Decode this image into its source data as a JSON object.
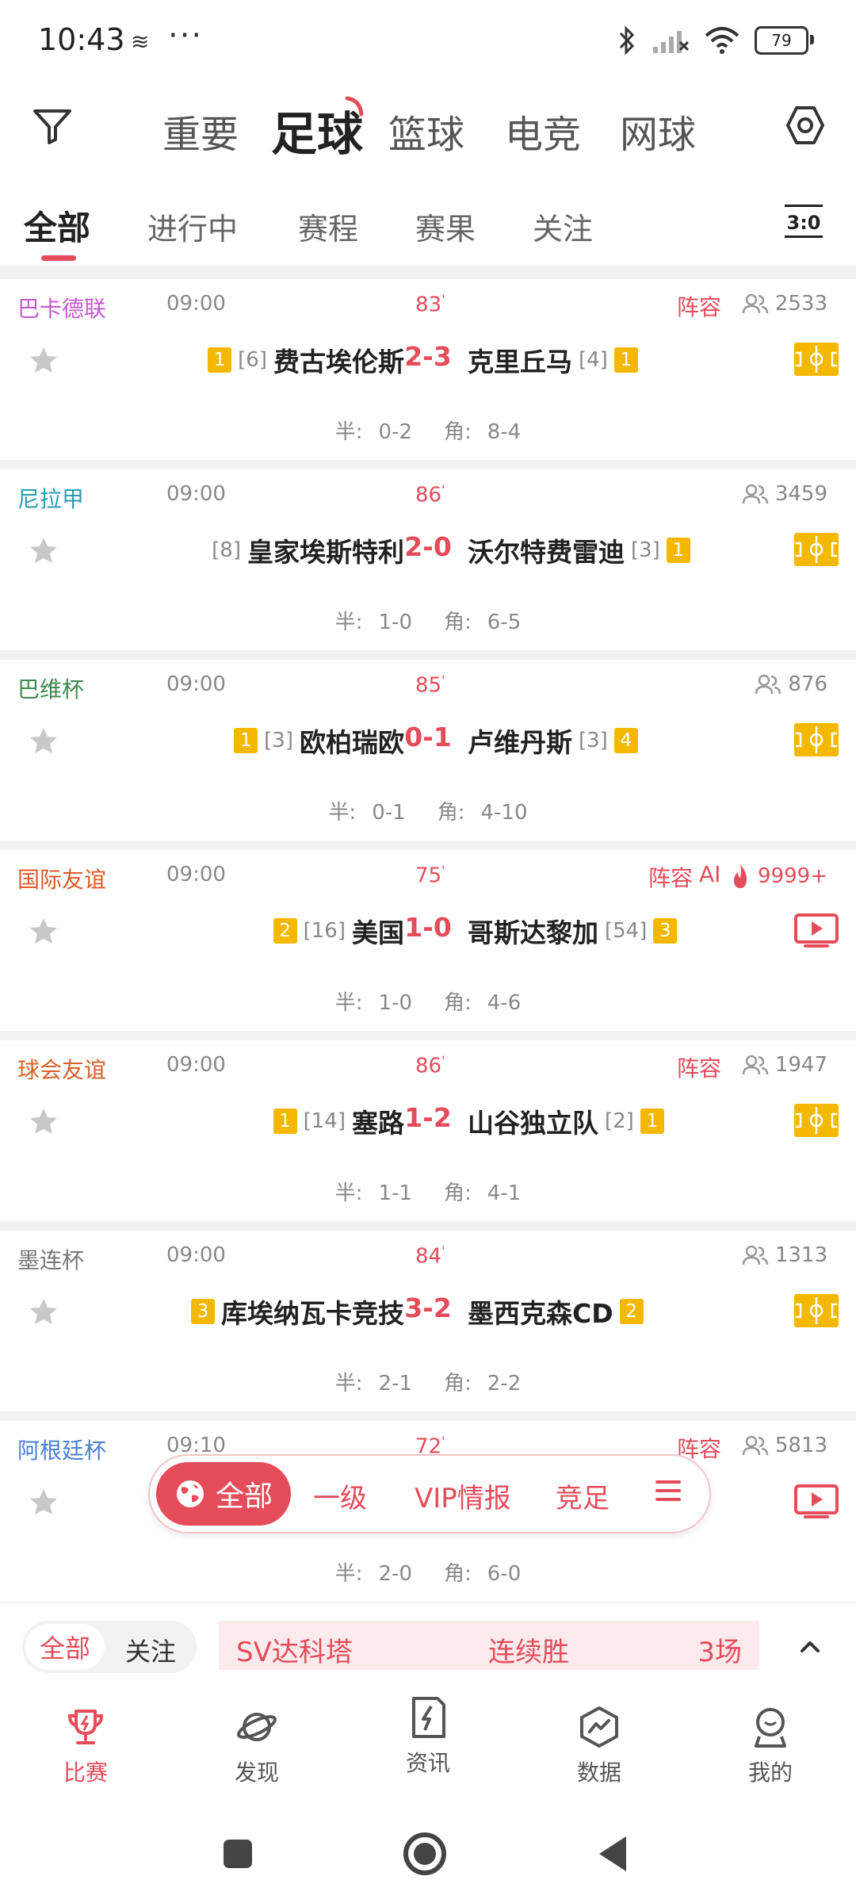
{
  "status": {
    "time": "10:43",
    "battery": "79"
  },
  "sports_tabs": [
    "重要",
    "足球",
    "篮球",
    "电竞",
    "网球"
  ],
  "sub_tabs": [
    "全部",
    "进行中",
    "赛程",
    "赛果",
    "关注"
  ],
  "colors": {
    "accent": "#e44c5a",
    "card_yellow": "#f5b800"
  },
  "matches": [
    {
      "league": "巴卡德联",
      "league_color": "#c45ad0",
      "time": "09:00",
      "minute": "83",
      "lineup": "阵容",
      "viewers": "2533",
      "home_card": "1",
      "home_rank": "[6]",
      "home": "费古埃伦斯",
      "score": "2-3",
      "away": "克里丘马",
      "away_rank": "[4]",
      "away_card": "1",
      "half_label": "半:",
      "half": "0-2",
      "corner_label": "角:",
      "corner": "8-4",
      "media": "pitch"
    },
    {
      "league": "尼拉甲",
      "league_color": "#2a9db4",
      "time": "09:00",
      "minute": "86",
      "lineup": "",
      "viewers": "3459",
      "home_card": "",
      "home_rank": "[8]",
      "home": "皇家埃斯特利",
      "score": "2-0",
      "away": "沃尔特费雷迪",
      "away_rank": "[3]",
      "away_card": "1",
      "half_label": "半:",
      "half": "1-0",
      "corner_label": "角:",
      "corner": "6-5",
      "media": "pitch"
    },
    {
      "league": "巴维杯",
      "league_color": "#3c8a4e",
      "time": "09:00",
      "minute": "85",
      "lineup": "",
      "viewers": "876",
      "home_card": "1",
      "home_rank": "[3]",
      "home": "欧柏瑞欧",
      "score": "0-1",
      "away": "卢维丹斯",
      "away_rank": "[3]",
      "away_card": "4",
      "half_label": "半:",
      "half": "0-1",
      "corner_label": "角:",
      "corner": "4-10",
      "media": "pitch"
    },
    {
      "league": "国际友谊",
      "league_color": "#e05a2a",
      "time": "09:00",
      "minute": "75",
      "lineup": "阵容",
      "ai": "AI",
      "viewers": "9999+",
      "hot": true,
      "home_card": "2",
      "home_rank": "[16]",
      "home": "美国",
      "score": "1-0",
      "away": "哥斯达黎加",
      "away_rank": "[54]",
      "away_card": "3",
      "half_label": "半:",
      "half": "1-0",
      "corner_label": "角:",
      "corner": "4-6",
      "media": "tv"
    },
    {
      "league": "球会友谊",
      "league_color": "#d4622a",
      "time": "09:00",
      "minute": "86",
      "lineup": "阵容",
      "viewers": "1947",
      "home_card": "1",
      "home_rank": "[14]",
      "home": "塞路",
      "score": "1-2",
      "away": "山谷独立队",
      "away_rank": "[2]",
      "away_card": "1",
      "half_label": "半:",
      "half": "1-1",
      "corner_label": "角:",
      "corner": "4-1",
      "media": "pitch"
    },
    {
      "league": "墨连杯",
      "league_color": "#777777",
      "time": "09:00",
      "minute": "84",
      "lineup": "",
      "viewers": "1313",
      "home_card": "3",
      "home_rank": "",
      "home": "库埃纳瓦卡竞技",
      "score": "3-2",
      "away": "墨西克森CD",
      "away_rank": "",
      "away_card": "2",
      "half_label": "半:",
      "half": "2-1",
      "corner_label": "角:",
      "corner": "2-2",
      "media": "pitch"
    },
    {
      "league": "阿根廷杯",
      "league_color": "#4a7fd4",
      "time": "09:10",
      "minute": "72",
      "lineup": "阵容",
      "viewers": "5813",
      "home_card": "",
      "home_rank": "",
      "home": "",
      "score": "",
      "away": "",
      "away_rank": "",
      "away_card": "",
      "half_label": "半:",
      "half": "2-0",
      "corner_label": "角:",
      "corner": "6-0",
      "media": "tv"
    }
  ],
  "float_bar": {
    "all": "全部",
    "level1": "一级",
    "vip": "VIP情报",
    "jingzu": "竞足"
  },
  "ticker": {
    "all": "全部",
    "follow": "关注",
    "team": "SV达科塔",
    "streak": "连续胜",
    "count": "3场"
  },
  "bottom_nav": [
    "比赛",
    "发现",
    "资讯",
    "数据",
    "我的"
  ]
}
